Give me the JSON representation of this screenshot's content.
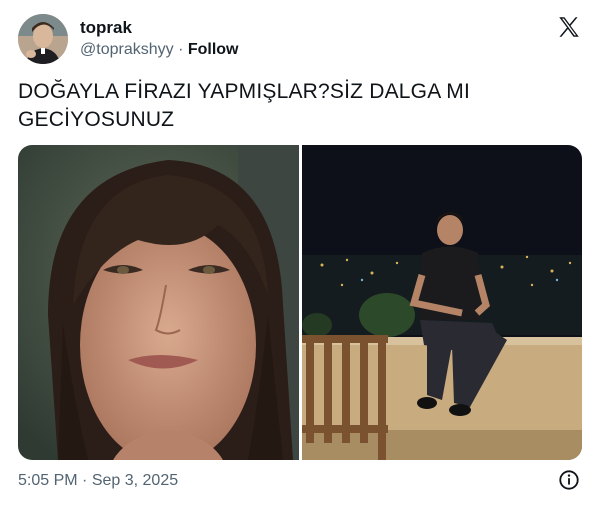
{
  "author": {
    "display_name": "toprak",
    "handle": "@toprakshyy",
    "separator": "·",
    "follow_label": "Follow"
  },
  "tweet": {
    "text": "DOĞAYLA FİRAZI YAPMIŞLAR?SİZ DALGA MI GECİYOSUNUZ",
    "time": "5:05 PM",
    "date_separator": "·",
    "date": "Sep 3, 2025"
  },
  "media": [
    {
      "kind": "photo",
      "subject": "woman-closeup"
    },
    {
      "kind": "photo",
      "subject": "man-on-balcony-night"
    }
  ],
  "icons": {
    "platform": "x-logo-icon",
    "info": "info-icon"
  },
  "colors": {
    "text_primary": "#0f1419",
    "text_secondary": "#536471",
    "background": "#ffffff"
  }
}
